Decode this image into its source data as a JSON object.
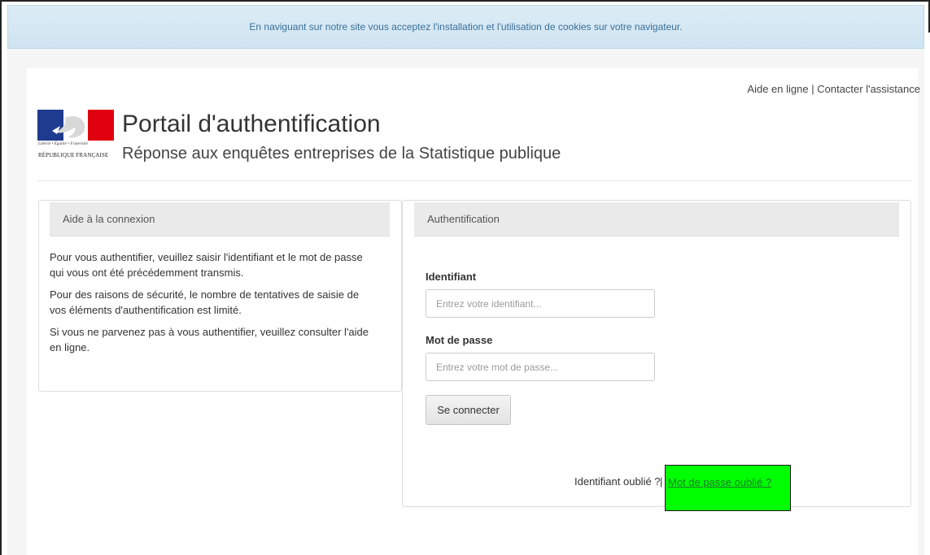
{
  "cookie_notice": "En naviguant sur notre site vous acceptez l'installation et l'utilisation de cookies sur votre navigateur.",
  "header": {
    "links": {
      "help": "Aide en ligne",
      "separator": "|",
      "contact": "Contacter l'assistance"
    },
    "logo": {
      "motto": "Liberté • Égalité • Fraternité",
      "country": "RÉPUBLIQUE FRANÇAISE"
    },
    "title": "Portail d'authentification",
    "subtitle": "Réponse aux enquêtes entreprises de la Statistique publique"
  },
  "help_panel": {
    "heading": "Aide à la connexion",
    "paragraphs": [
      "Pour vous authentifier, veuillez saisir l'identifiant et le mot de passe qui vous ont été précédemment transmis.",
      "Pour des raisons de sécurité, le nombre de tentatives de saisie de vos éléments d'authentification est limité.",
      "Si vous ne parvenez pas à  vous authentifier, veuillez consulter l'aide en ligne."
    ]
  },
  "auth_panel": {
    "heading": "Authentification",
    "username_label": "Identifiant",
    "username_placeholder": "Entrez votre identifiant...",
    "password_label": "Mot de passe",
    "password_placeholder": "Entrez votre mot de passe...",
    "submit_label": "Se connecter",
    "forgot_id": "Identifiant oublié ?",
    "forgot_separator": "|",
    "forgot_password": "Mot de passe oublié ?"
  },
  "colors": {
    "cookie_bar": "#cfe4f1",
    "highlight": "#00ff00",
    "flag_blue": "#1f3b8f",
    "flag_red": "#e1000f"
  }
}
